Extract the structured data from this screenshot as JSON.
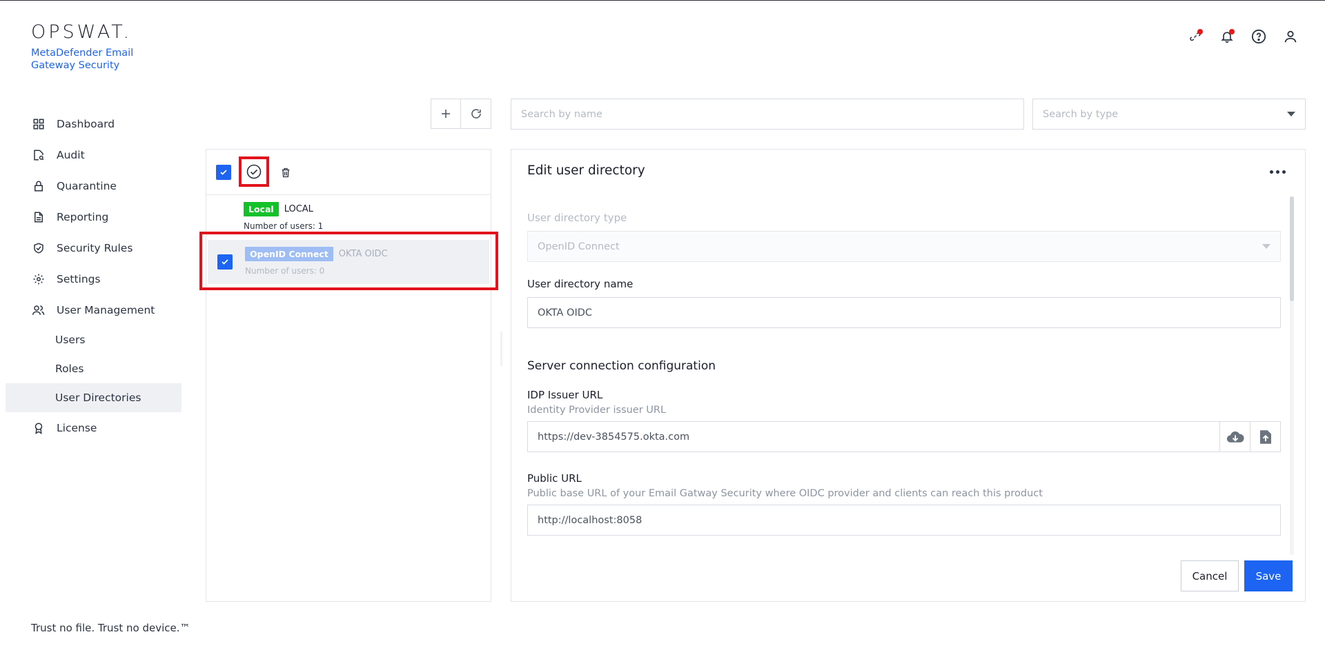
{
  "brand": {
    "logo": "OPSWAT.",
    "product": "MetaDefender Email Gateway Security"
  },
  "topbar": {
    "icons": [
      "link-icon",
      "bell-icon",
      "help-icon",
      "user-icon"
    ]
  },
  "sidebar": {
    "items": [
      {
        "label": "Dashboard",
        "icon": "dashboard-icon"
      },
      {
        "label": "Audit",
        "icon": "audit-icon"
      },
      {
        "label": "Quarantine",
        "icon": "lock-icon"
      },
      {
        "label": "Reporting",
        "icon": "document-icon"
      },
      {
        "label": "Security Rules",
        "icon": "shield-check-icon"
      },
      {
        "label": "Settings",
        "icon": "gear-icon"
      },
      {
        "label": "User Management",
        "icon": "users-icon"
      }
    ],
    "sub_items": [
      {
        "label": "Users"
      },
      {
        "label": "Roles"
      },
      {
        "label": "User Directories",
        "active": true
      }
    ],
    "license": {
      "label": "License",
      "icon": "award-icon"
    },
    "footer": "Trust no file. Trust no device.™"
  },
  "search": {
    "name_placeholder": "Search by name",
    "type_placeholder": "Search by type"
  },
  "directories": [
    {
      "badge": "Local",
      "name": "LOCAL",
      "count": "Number of users: 1",
      "selected": false
    },
    {
      "badge": "OpenID Connect",
      "name": "OKTA OIDC",
      "count": "Number of users: 0",
      "selected": true
    }
  ],
  "edit": {
    "title": "Edit user directory",
    "type_label": "User directory type",
    "type_value": "OpenID Connect",
    "name_label": "User directory name",
    "name_value": "OKTA OIDC",
    "section_title": "Server connection configuration",
    "idp_label": "IDP Issuer URL",
    "idp_desc": "Identity Provider issuer URL",
    "idp_value": "https://dev-3854575.okta.com",
    "public_label": "Public URL",
    "public_desc": "Public base URL of your Email Gatway Security where OIDC provider and clients can reach this product",
    "public_value": "http://localhost:8058",
    "cancel_label": "Cancel",
    "save_label": "Save"
  },
  "colors": {
    "accent": "#1d64f2",
    "local_badge": "#15c12a",
    "oidc_badge": "#9fbdf5",
    "highlight": "#e1141d"
  }
}
